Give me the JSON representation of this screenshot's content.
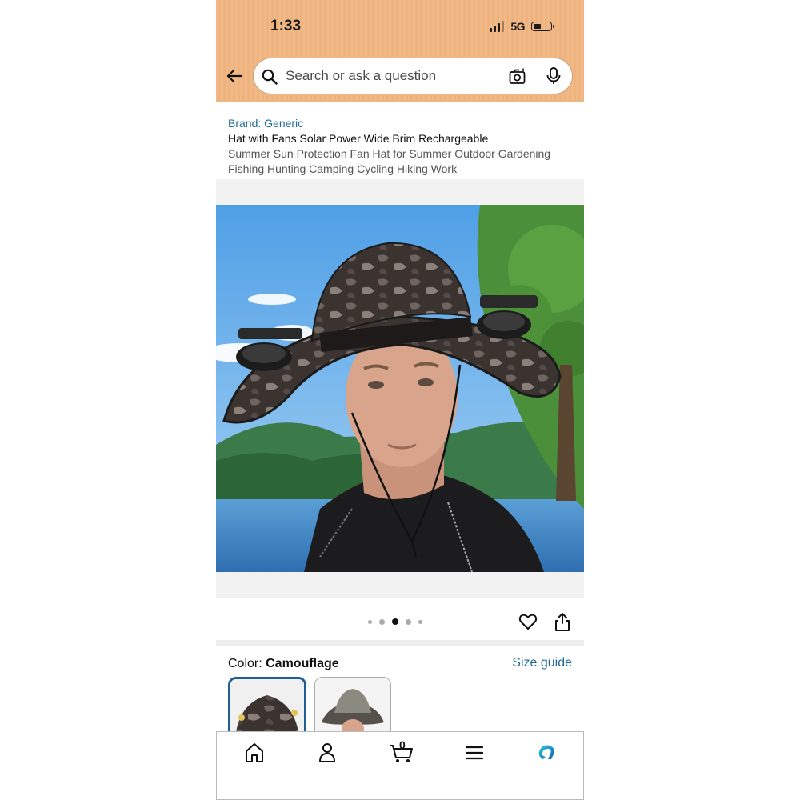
{
  "status_bar": {
    "time": "1:33",
    "network": "5G"
  },
  "search": {
    "placeholder": "Search or ask a question"
  },
  "product": {
    "brand": "Brand: Generic",
    "title_line1": "Hat with Fans Solar Power Wide Brim Rechargeable",
    "title_rest": "Summer Sun Protection Fan Hat for Summer Outdoor Gardening Fishing Hunting Camping Cycling Hiking Work"
  },
  "gallery": {
    "image_count": 5,
    "active_index": 2
  },
  "color": {
    "label": "Color: ",
    "value": "Camouflage",
    "size_guide": "Size guide"
  },
  "nav": {
    "cart_count": "0"
  },
  "icons": [
    "back-arrow-icon",
    "search-icon",
    "camera-icon",
    "mic-icon",
    "heart-icon",
    "share-icon",
    "home-icon",
    "account-icon",
    "cart-icon",
    "menu-icon",
    "rufus-icon"
  ],
  "colors": {
    "header": "#f0b985",
    "link": "#1f6a99",
    "swatch_selected": "#1f5f93"
  }
}
